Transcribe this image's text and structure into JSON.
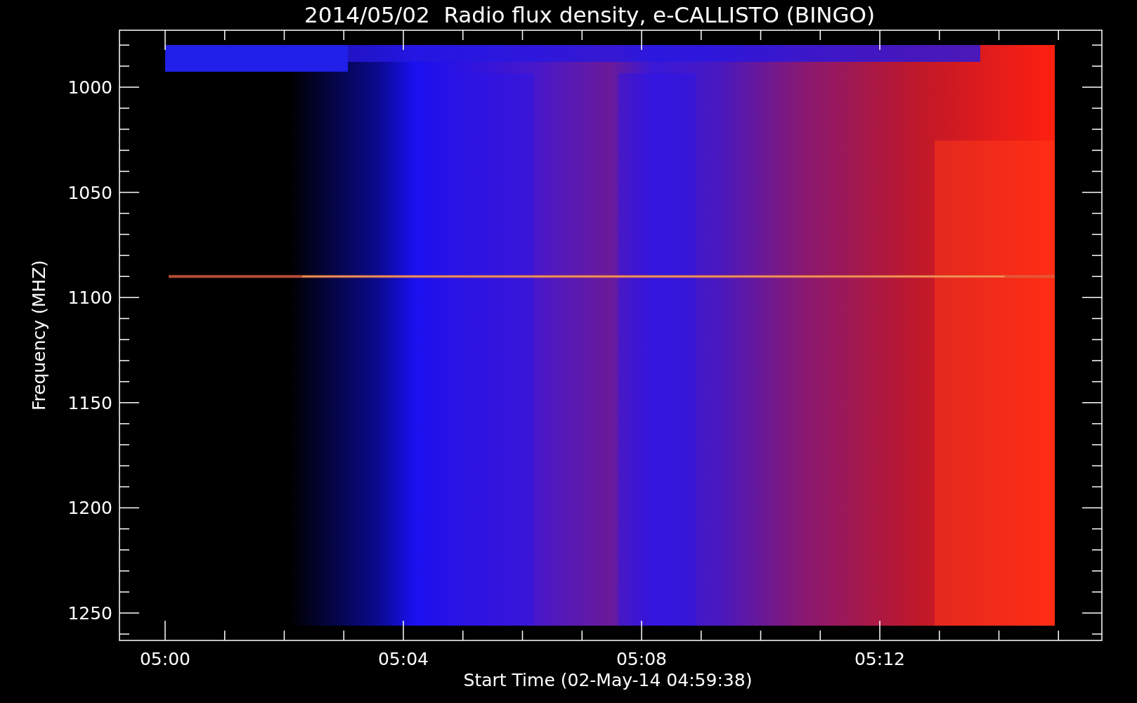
{
  "title": "2014/05/02  Radio flux density, e-CALLISTO (BINGO)",
  "y_axis": {
    "label": "Frequency (MHZ)",
    "ticks": [
      "1000",
      "1050",
      "1100",
      "1150",
      "1200",
      "1250"
    ]
  },
  "x_axis": {
    "label": "Start Time (02-May-14 04:59:38)",
    "ticks": [
      "05:00",
      "05:04",
      "05:08",
      "05:12"
    ]
  }
}
